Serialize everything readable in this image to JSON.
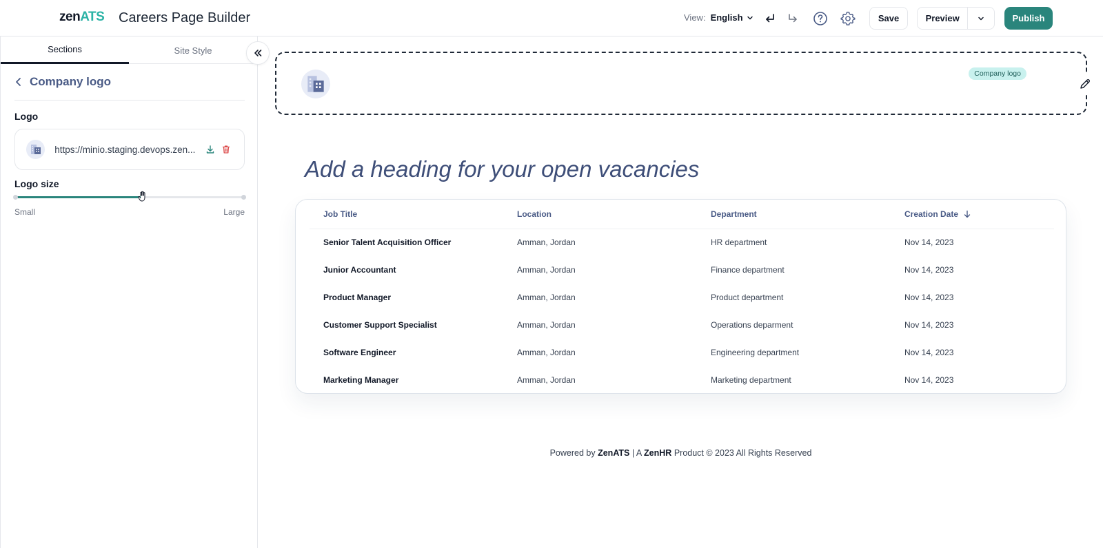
{
  "header": {
    "logo_zen": "zen",
    "logo_ats": "ATS",
    "title": "Careers Page Builder",
    "view_label": "View:",
    "view_value": "English",
    "save_label": "Save",
    "preview_label": "Preview",
    "publish_label": "Publish"
  },
  "sidebar": {
    "tabs": [
      {
        "label": "Sections",
        "active": true
      },
      {
        "label": "Site Style",
        "active": false
      }
    ],
    "back_title": "Company logo",
    "logo_label": "Logo",
    "logo_url": "https://minio.staging.devops.zen...",
    "logo_size_label": "Logo size",
    "logo_size_value": 0.56,
    "slider_min_label": "Small",
    "slider_max_label": "Large"
  },
  "main": {
    "logo_section_badge": "Company logo",
    "heading": "Add a heading for your open vacancies",
    "table": {
      "columns": [
        "Job Title",
        "Location",
        "Department",
        "Creation Date"
      ],
      "rows": [
        [
          "Senior Talent Acquisition Officer",
          "Amman, Jordan",
          "HR department",
          "Nov 14, 2023"
        ],
        [
          "Junior Accountant",
          "Amman, Jordan",
          "Finance department",
          "Nov 14, 2023"
        ],
        [
          "Product Manager",
          "Amman, Jordan",
          "Product department",
          "Nov 14, 2023"
        ],
        [
          "Customer Support Specialist",
          "Amman, Jordan",
          "Operations deparment",
          "Nov 14, 2023"
        ],
        [
          "Software Engineer",
          "Amman, Jordan",
          "Engineering department",
          "Nov 14, 2023"
        ],
        [
          "Marketing Manager",
          "Amman, Jordan",
          "Marketing department",
          "Nov 14, 2023"
        ]
      ]
    },
    "footer": {
      "powered_by": "Powered by",
      "brand": "ZenATS",
      "separator": "| A",
      "company": "ZenHR",
      "suffix": "Product © 2023 All Rights Reserved"
    }
  },
  "colors": {
    "accent": "#2a857c",
    "brand_teal": "#2bb3a6",
    "heading": "#3e4e78",
    "badge_bg": "#c8f1ee"
  },
  "icons": [
    "undo-icon",
    "redo-icon",
    "help-icon",
    "gear-icon",
    "chevron-down-icon",
    "double-chevron-left-icon",
    "chevron-left-icon",
    "building-icon",
    "download-icon",
    "trash-icon",
    "grab-hand-icon",
    "pencil-icon",
    "arrow-down-icon"
  ]
}
